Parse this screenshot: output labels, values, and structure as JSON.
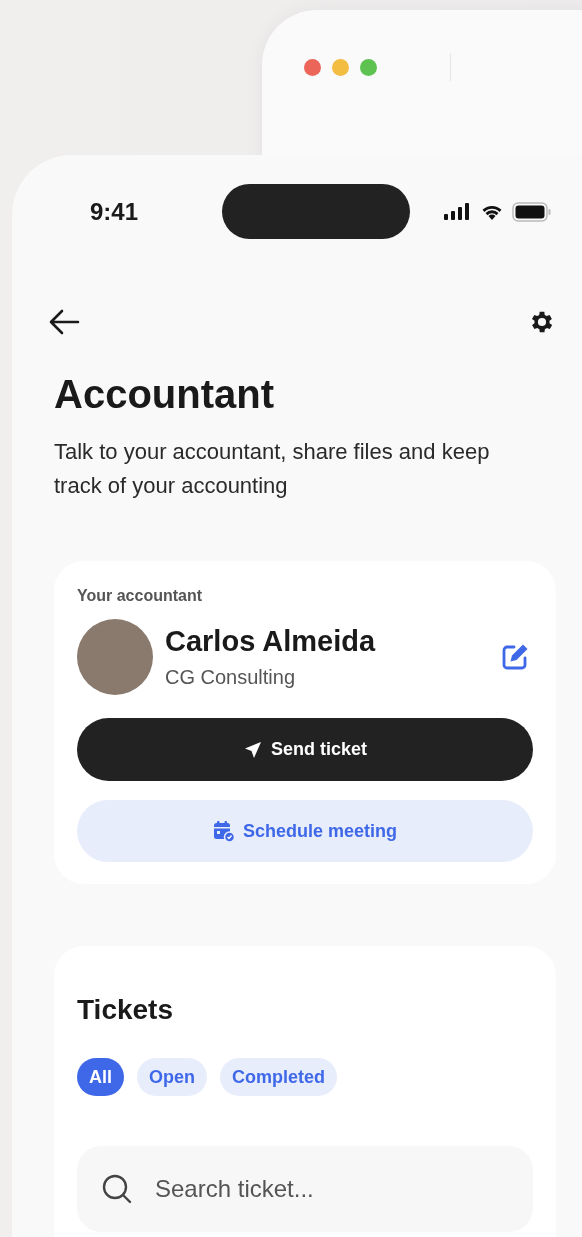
{
  "status_bar": {
    "time": "9:41"
  },
  "header": {
    "title": "Accountant",
    "subtitle": "Talk to your accountant, share files and keep track of your accounting"
  },
  "accountant_card": {
    "label": "Your accountant",
    "name": "Carlos Almeida",
    "company": "CG Consulting",
    "buttons": [
      {
        "kind": "primary",
        "label": "Send ticket"
      },
      {
        "kind": "secondary",
        "label": "Schedule meeting"
      }
    ]
  },
  "tickets": {
    "title": "Tickets",
    "filters": [
      {
        "label": "All",
        "selected": true
      },
      {
        "label": "Open",
        "selected": false
      },
      {
        "label": "Completed",
        "selected": false
      }
    ],
    "search": {
      "placeholder": "Search ticket..."
    }
  }
}
